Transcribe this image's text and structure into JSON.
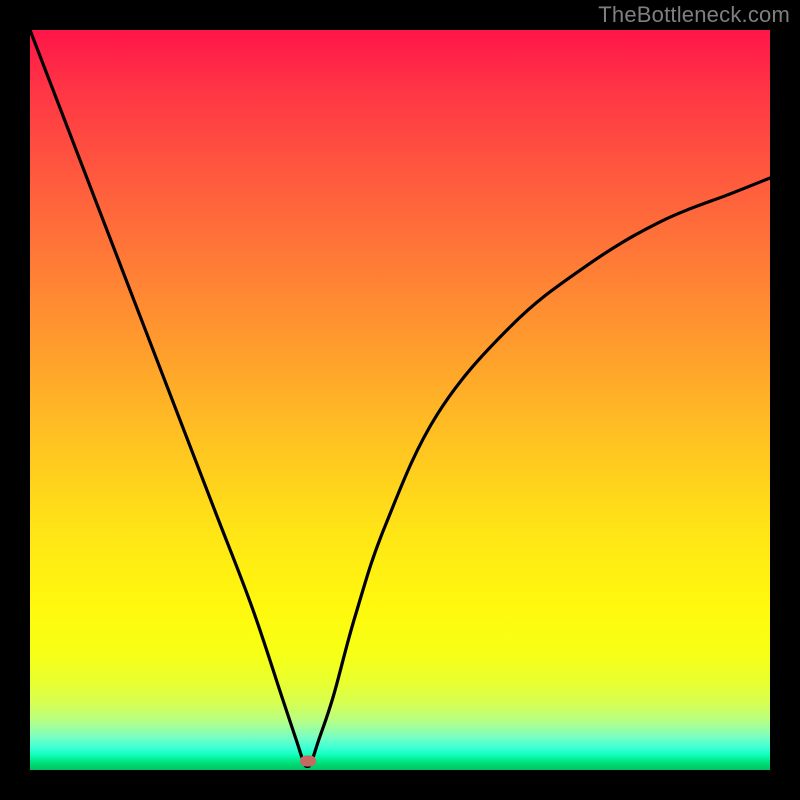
{
  "watermark": "TheBottleneck.com",
  "colors": {
    "gradient_top": "#ff1549",
    "gradient_bottom": "#00c45f",
    "curve": "#000000",
    "marker": "#c46a63",
    "frame": "#000000"
  },
  "chart_data": {
    "type": "line",
    "title": "",
    "xlabel": "",
    "ylabel": "",
    "xlim": [
      0,
      100
    ],
    "ylim": [
      0,
      100
    ],
    "grid": false,
    "legend": false,
    "series": [
      {
        "name": "bottleneck-curve",
        "x": [
          0,
          5,
          10,
          15,
          20,
          25,
          30,
          34,
          36,
          37,
          37.5,
          38,
          39,
          41,
          44,
          48,
          55,
          65,
          75,
          85,
          95,
          100
        ],
        "y": [
          100,
          87,
          74,
          61,
          48,
          35,
          22,
          10,
          4,
          1,
          0.5,
          1,
          4,
          10,
          21,
          33,
          48,
          60,
          68,
          74,
          78,
          80
        ]
      }
    ],
    "marker": {
      "x": 37.5,
      "y": 1.2
    },
    "notch_x": 37.5
  }
}
